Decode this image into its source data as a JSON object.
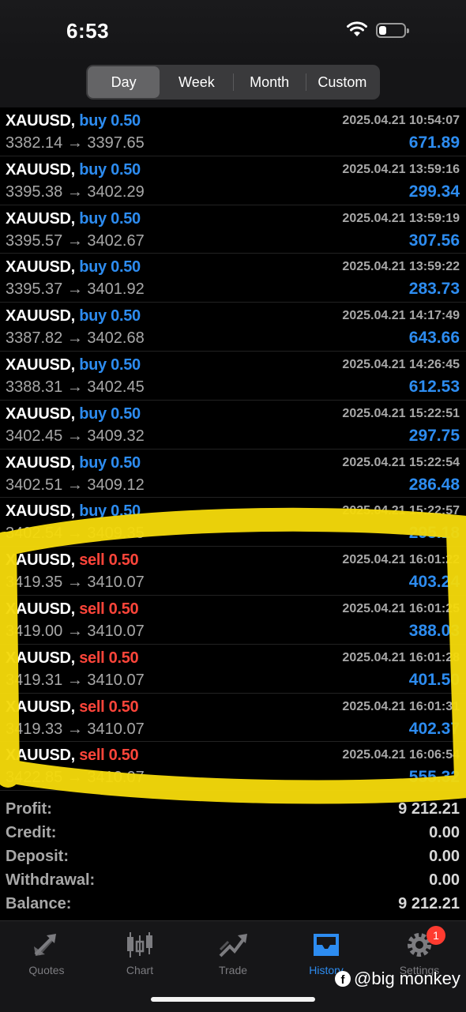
{
  "status": {
    "time": "6:53"
  },
  "periods": [
    "Day",
    "Week",
    "Month",
    "Custom"
  ],
  "active_period": "Day",
  "deals": [
    {
      "symbol": "XAUUSD,",
      "side": "buy",
      "volume": "0.50",
      "datetime": "2025.04.21 10:54:07",
      "open": "3382.14",
      "close": "3397.65",
      "profit": "671.89"
    },
    {
      "symbol": "XAUUSD,",
      "side": "buy",
      "volume": "0.50",
      "datetime": "2025.04.21 13:59:16",
      "open": "3395.38",
      "close": "3402.29",
      "profit": "299.34"
    },
    {
      "symbol": "XAUUSD,",
      "side": "buy",
      "volume": "0.50",
      "datetime": "2025.04.21 13:59:19",
      "open": "3395.57",
      "close": "3402.67",
      "profit": "307.56"
    },
    {
      "symbol": "XAUUSD,",
      "side": "buy",
      "volume": "0.50",
      "datetime": "2025.04.21 13:59:22",
      "open": "3395.37",
      "close": "3401.92",
      "profit": "283.73"
    },
    {
      "symbol": "XAUUSD,",
      "side": "buy",
      "volume": "0.50",
      "datetime": "2025.04.21 14:17:49",
      "open": "3387.82",
      "close": "3402.68",
      "profit": "643.66"
    },
    {
      "symbol": "XAUUSD,",
      "side": "buy",
      "volume": "0.50",
      "datetime": "2025.04.21 14:26:45",
      "open": "3388.31",
      "close": "3402.45",
      "profit": "612.53"
    },
    {
      "symbol": "XAUUSD,",
      "side": "buy",
      "volume": "0.50",
      "datetime": "2025.04.21 15:22:51",
      "open": "3402.45",
      "close": "3409.32",
      "profit": "297.75"
    },
    {
      "symbol": "XAUUSD,",
      "side": "buy",
      "volume": "0.50",
      "datetime": "2025.04.21 15:22:54",
      "open": "3402.51",
      "close": "3409.12",
      "profit": "286.48"
    },
    {
      "symbol": "XAUUSD,",
      "side": "buy",
      "volume": "0.50",
      "datetime": "2025.04.21 15:22:57",
      "open": "3402.54",
      "close": "3409.35",
      "profit": "295.18"
    },
    {
      "symbol": "XAUUSD,",
      "side": "sell",
      "volume": "0.50",
      "datetime": "2025.04.21 16:01:22",
      "open": "3419.35",
      "close": "3410.07",
      "profit": "403.24"
    },
    {
      "symbol": "XAUUSD,",
      "side": "sell",
      "volume": "0.50",
      "datetime": "2025.04.21 16:01:25",
      "open": "3419.00",
      "close": "3410.07",
      "profit": "388.03"
    },
    {
      "symbol": "XAUUSD,",
      "side": "sell",
      "volume": "0.50",
      "datetime": "2025.04.21 16:01:28",
      "open": "3419.31",
      "close": "3410.07",
      "profit": "401.50"
    },
    {
      "symbol": "XAUUSD,",
      "side": "sell",
      "volume": "0.50",
      "datetime": "2025.04.21 16:01:31",
      "open": "3419.33",
      "close": "3410.07",
      "profit": "402.37"
    },
    {
      "symbol": "XAUUSD,",
      "side": "sell",
      "volume": "0.50",
      "datetime": "2025.04.21 16:06:54",
      "open": "3422.85",
      "close": "3410.07",
      "profit": "555.32"
    }
  ],
  "arrow": "→",
  "summary": [
    {
      "label": "Profit:",
      "value": "9 212.21"
    },
    {
      "label": "Credit:",
      "value": "0.00"
    },
    {
      "label": "Deposit:",
      "value": "0.00"
    },
    {
      "label": "Withdrawal:",
      "value": "0.00"
    },
    {
      "label": "Balance:",
      "value": "9 212.21"
    }
  ],
  "tabs": [
    {
      "label": "Quotes",
      "icon": "quotes-icon"
    },
    {
      "label": "Chart",
      "icon": "chart-icon"
    },
    {
      "label": "Trade",
      "icon": "trade-icon"
    },
    {
      "label": "History",
      "icon": "history-icon"
    },
    {
      "label": "Settings",
      "icon": "gear-icon",
      "badge": "1"
    }
  ],
  "active_tab": "History",
  "watermark": "@big monkey",
  "colors": {
    "buy": "#2d8cf0",
    "sell": "#ff453a",
    "profit": "#2d8cf0",
    "highlight": "#f4d90a",
    "badge": "#ff3b30"
  }
}
